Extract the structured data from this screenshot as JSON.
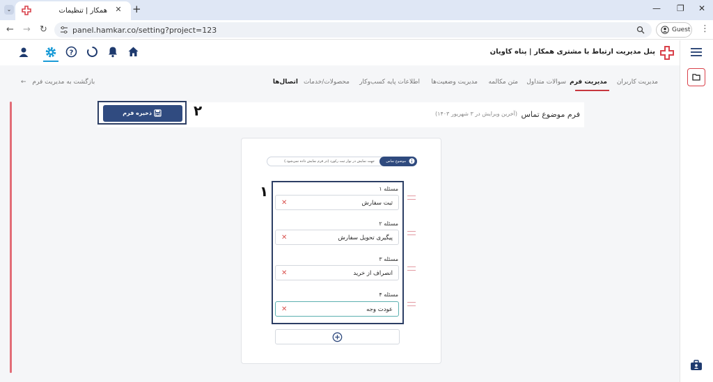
{
  "browser": {
    "tab_title": "همکار | تنظیمات",
    "url": "panel.hamkar.co/setting?project=123",
    "profile": "Guest"
  },
  "app": {
    "title": "پنل مدیریت ارتباط با مشتری همکار | پناه کاویان",
    "accent": "#c7373e",
    "primary": "#304b80"
  },
  "subnav": {
    "items": [
      "مدیریت کاربران",
      "مدیریت فرم",
      "سوالات متداول",
      "متن مکالمه",
      "مدیریت وضعیت‌ها",
      "اطلاعات پایه کسب‌وکار",
      "محصولات/خدمات",
      "اتصال‌ها"
    ],
    "active": "مدیریت فرم",
    "back": "بازگشت به مدیریت فرم"
  },
  "form": {
    "title": "فرم موضوع تماس",
    "subtitle": "(آخرین ویرایش در ۳ شهریور ۱۴۰۳)",
    "save_label": "ذخیره فرم",
    "pill_label": "موضوع تماس",
    "pill_hint": "جهت نمایش در نوار ثبت رکورد (در فرم نمایش داده نمی‌شود.)",
    "marker_save": "۲",
    "marker_list": "۱",
    "questions": [
      {
        "label": "مسئله ۱",
        "value": "ثبت سفارش"
      },
      {
        "label": "مسئله ۲",
        "value": "پیگیری تحویل سفارش"
      },
      {
        "label": "مسئله ۳",
        "value": "انصراف از خرید"
      },
      {
        "label": "مسئله ۴",
        "value": "عودت وجه"
      }
    ]
  }
}
